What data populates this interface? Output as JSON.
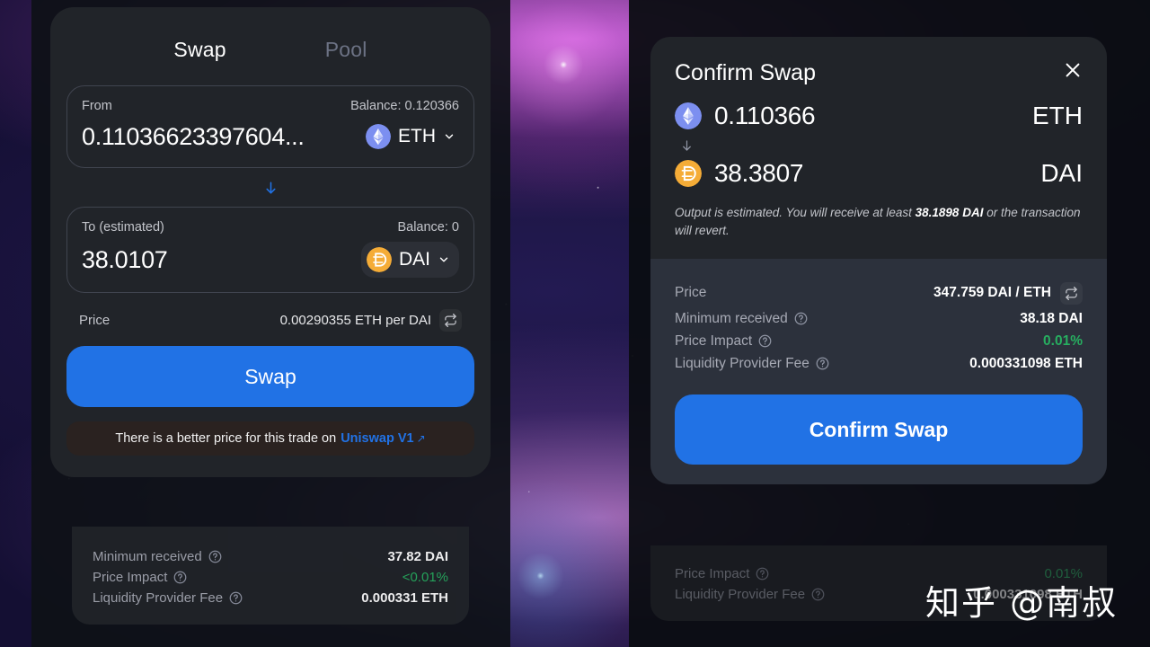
{
  "left_panel": {
    "tabs": [
      {
        "label": "Swap",
        "state": "active"
      },
      {
        "label": "Pool",
        "state": "inactive"
      }
    ],
    "from": {
      "label": "From",
      "balance": "Balance: 0.120366",
      "amount": "0.11036623397604...",
      "token": "ETH",
      "token_icon": "ethereum-icon",
      "chevron_icon": "chevron-down-icon"
    },
    "swap_direction_icon": "arrow-down-icon",
    "to": {
      "label": "To (estimated)",
      "balance": "Balance: 0",
      "amount": "38.0107",
      "token": "DAI",
      "token_icon": "dai-icon",
      "chevron_icon": "chevron-down-icon"
    },
    "price": {
      "label": "Price",
      "value": "0.00290355 ETH per DAI",
      "toggle_icon": "repeat-icon"
    },
    "swap_button": "Swap",
    "better_price_banner": {
      "text": "There is a better price for this trade on",
      "link": "Uniswap V1",
      "link_icon": "external-link-icon"
    },
    "details": [
      {
        "label": "Minimum received",
        "value": "37.82 DAI",
        "tone": "normal",
        "help_icon": "question-icon"
      },
      {
        "label": "Price Impact",
        "value": "<0.01%",
        "tone": "green",
        "help_icon": "question-icon"
      },
      {
        "label": "Liquidity Provider Fee",
        "value": "0.000331 ETH",
        "tone": "normal",
        "help_icon": "question-icon"
      }
    ]
  },
  "modal": {
    "title": "Confirm Swap",
    "close_icon": "close-icon",
    "from": {
      "amount": "0.110366",
      "symbol": "ETH",
      "token_icon": "ethereum-icon"
    },
    "arrow_icon": "arrow-down-icon",
    "to": {
      "amount": "38.3807",
      "symbol": "DAI",
      "token_icon": "dai-icon"
    },
    "note": {
      "prefix": "Output is estimated. You will receive at least ",
      "emphasis": "38.1898 DAI",
      "suffix": " or the transaction will revert."
    },
    "details": [
      {
        "label": "Price",
        "value": "347.759 DAI / ETH",
        "tone": "normal",
        "toggle_icon": "repeat-icon"
      },
      {
        "label": "Minimum received",
        "value": "38.18 DAI",
        "tone": "normal",
        "help_icon": "question-icon"
      },
      {
        "label": "Price Impact",
        "value": "0.01%",
        "tone": "green",
        "help_icon": "question-icon"
      },
      {
        "label": "Liquidity Provider Fee",
        "value": "0.000331098 ETH",
        "tone": "normal",
        "help_icon": "question-icon"
      }
    ],
    "confirm_button": "Confirm Swap"
  },
  "right_panel_background": {
    "details": [
      {
        "label": "Price Impact",
        "value": "0.01%",
        "tone": "green",
        "help_icon": "question-icon"
      },
      {
        "label": "Liquidity Provider Fee",
        "value": "0.000331098 ETH",
        "tone": "normal",
        "help_icon": "question-icon"
      }
    ]
  },
  "watermark": "知乎 @南叔",
  "colors": {
    "accent_blue": "#2172e5",
    "card_bg": "#212429",
    "modal_detail_bg": "#2c313c",
    "green": "#27ae60",
    "eth_icon": "#627eea",
    "dai_icon": "#f5ac37",
    "muted_text": "#a6a9b4"
  }
}
